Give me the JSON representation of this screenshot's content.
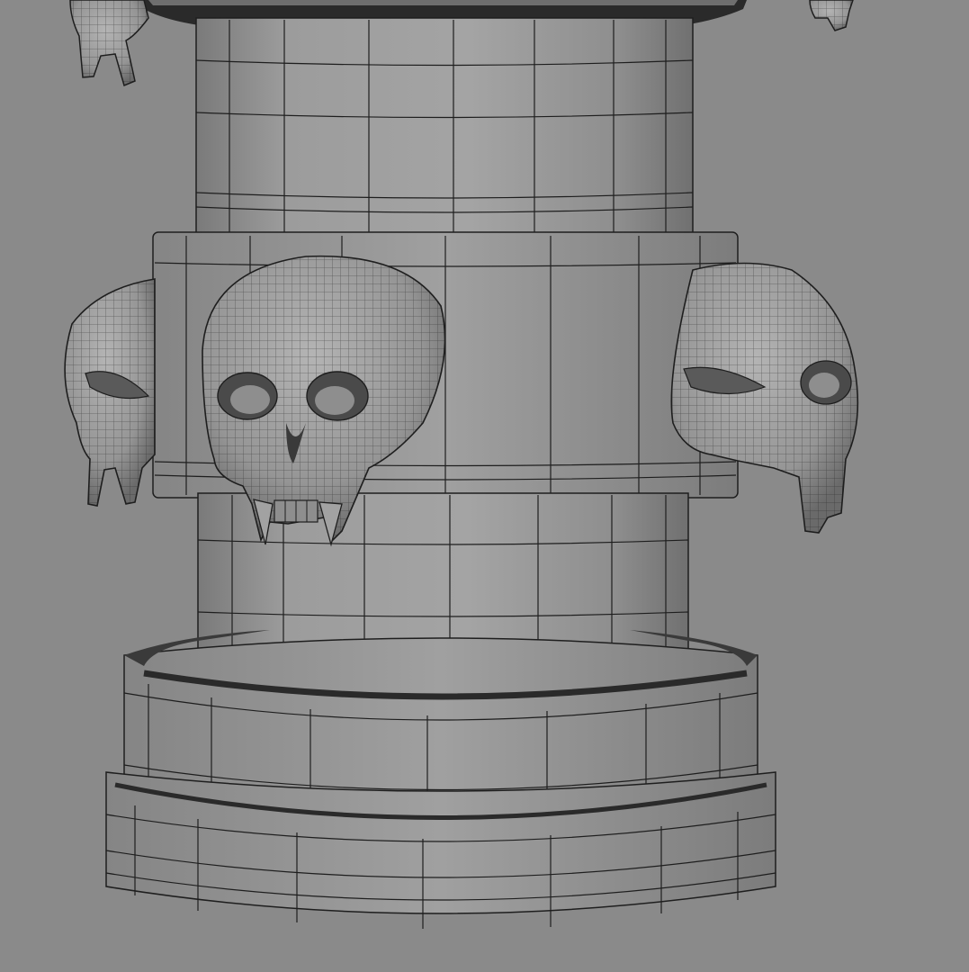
{
  "scene": {
    "subject": "wireframe-pillar-with-skulls",
    "colors": {
      "background": "#8a8a8a",
      "surface": "#9a9a9a",
      "surface_light": "#a8a8a8",
      "surface_dark": "#6e6e6e",
      "wire": "#1e1e1e",
      "cap_dark": "#2a2a2a"
    }
  }
}
